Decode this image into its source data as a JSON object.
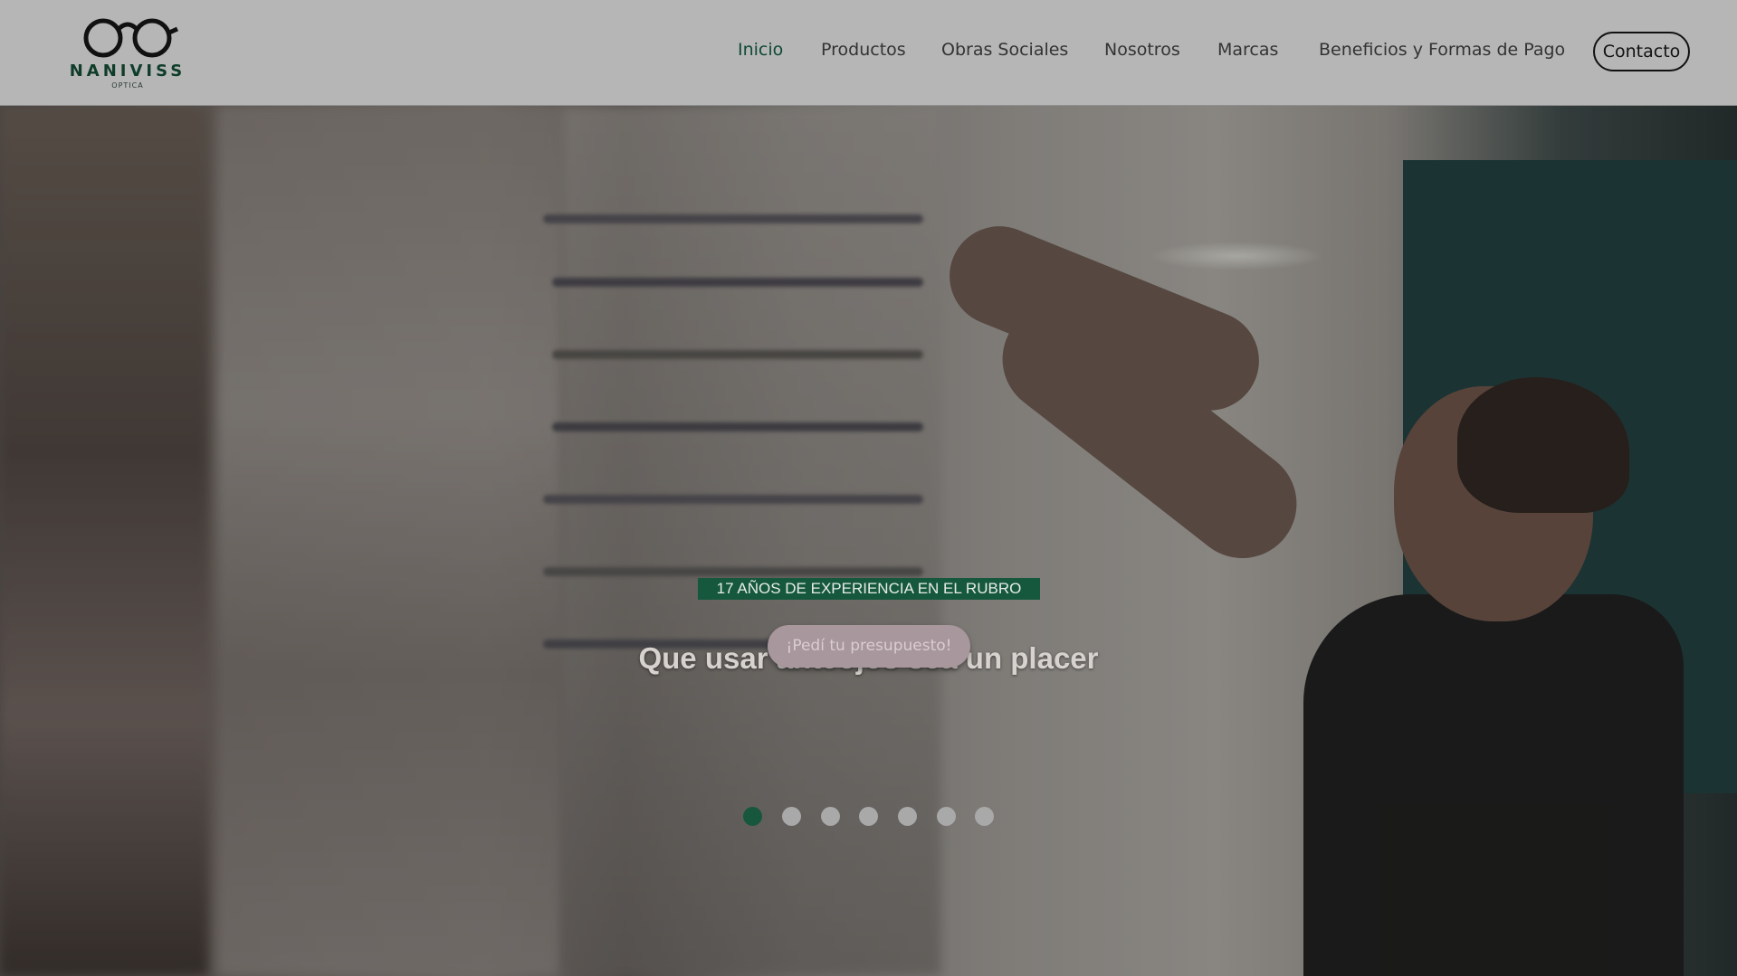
{
  "brand": {
    "name": "NANIVISS",
    "subtitle": "OPTICA"
  },
  "nav": {
    "items": [
      {
        "label": "Inicio",
        "active": true
      },
      {
        "label": "Productos",
        "active": false
      },
      {
        "label": "Obras Sociales",
        "active": false
      },
      {
        "label": "Nosotros",
        "active": false
      },
      {
        "label": "Marcas",
        "active": false
      },
      {
        "label": "Beneficios y Formas de Pago",
        "active": false
      }
    ],
    "contact_label": "Contacto"
  },
  "hero": {
    "title": "Que usar anteojos sea un placer",
    "subtitle": "17 AÑOS DE EXPERIENCIA EN EL RUBRO",
    "cta_label": "¡Pedí tu presupuesto!",
    "slides_total": 7,
    "active_slide": 1
  },
  "colors": {
    "header_bg": "#b6b6b6",
    "brand_green": "#0f3d2a",
    "accent_green": "#17573d",
    "cta_bg": "#a8979d"
  }
}
